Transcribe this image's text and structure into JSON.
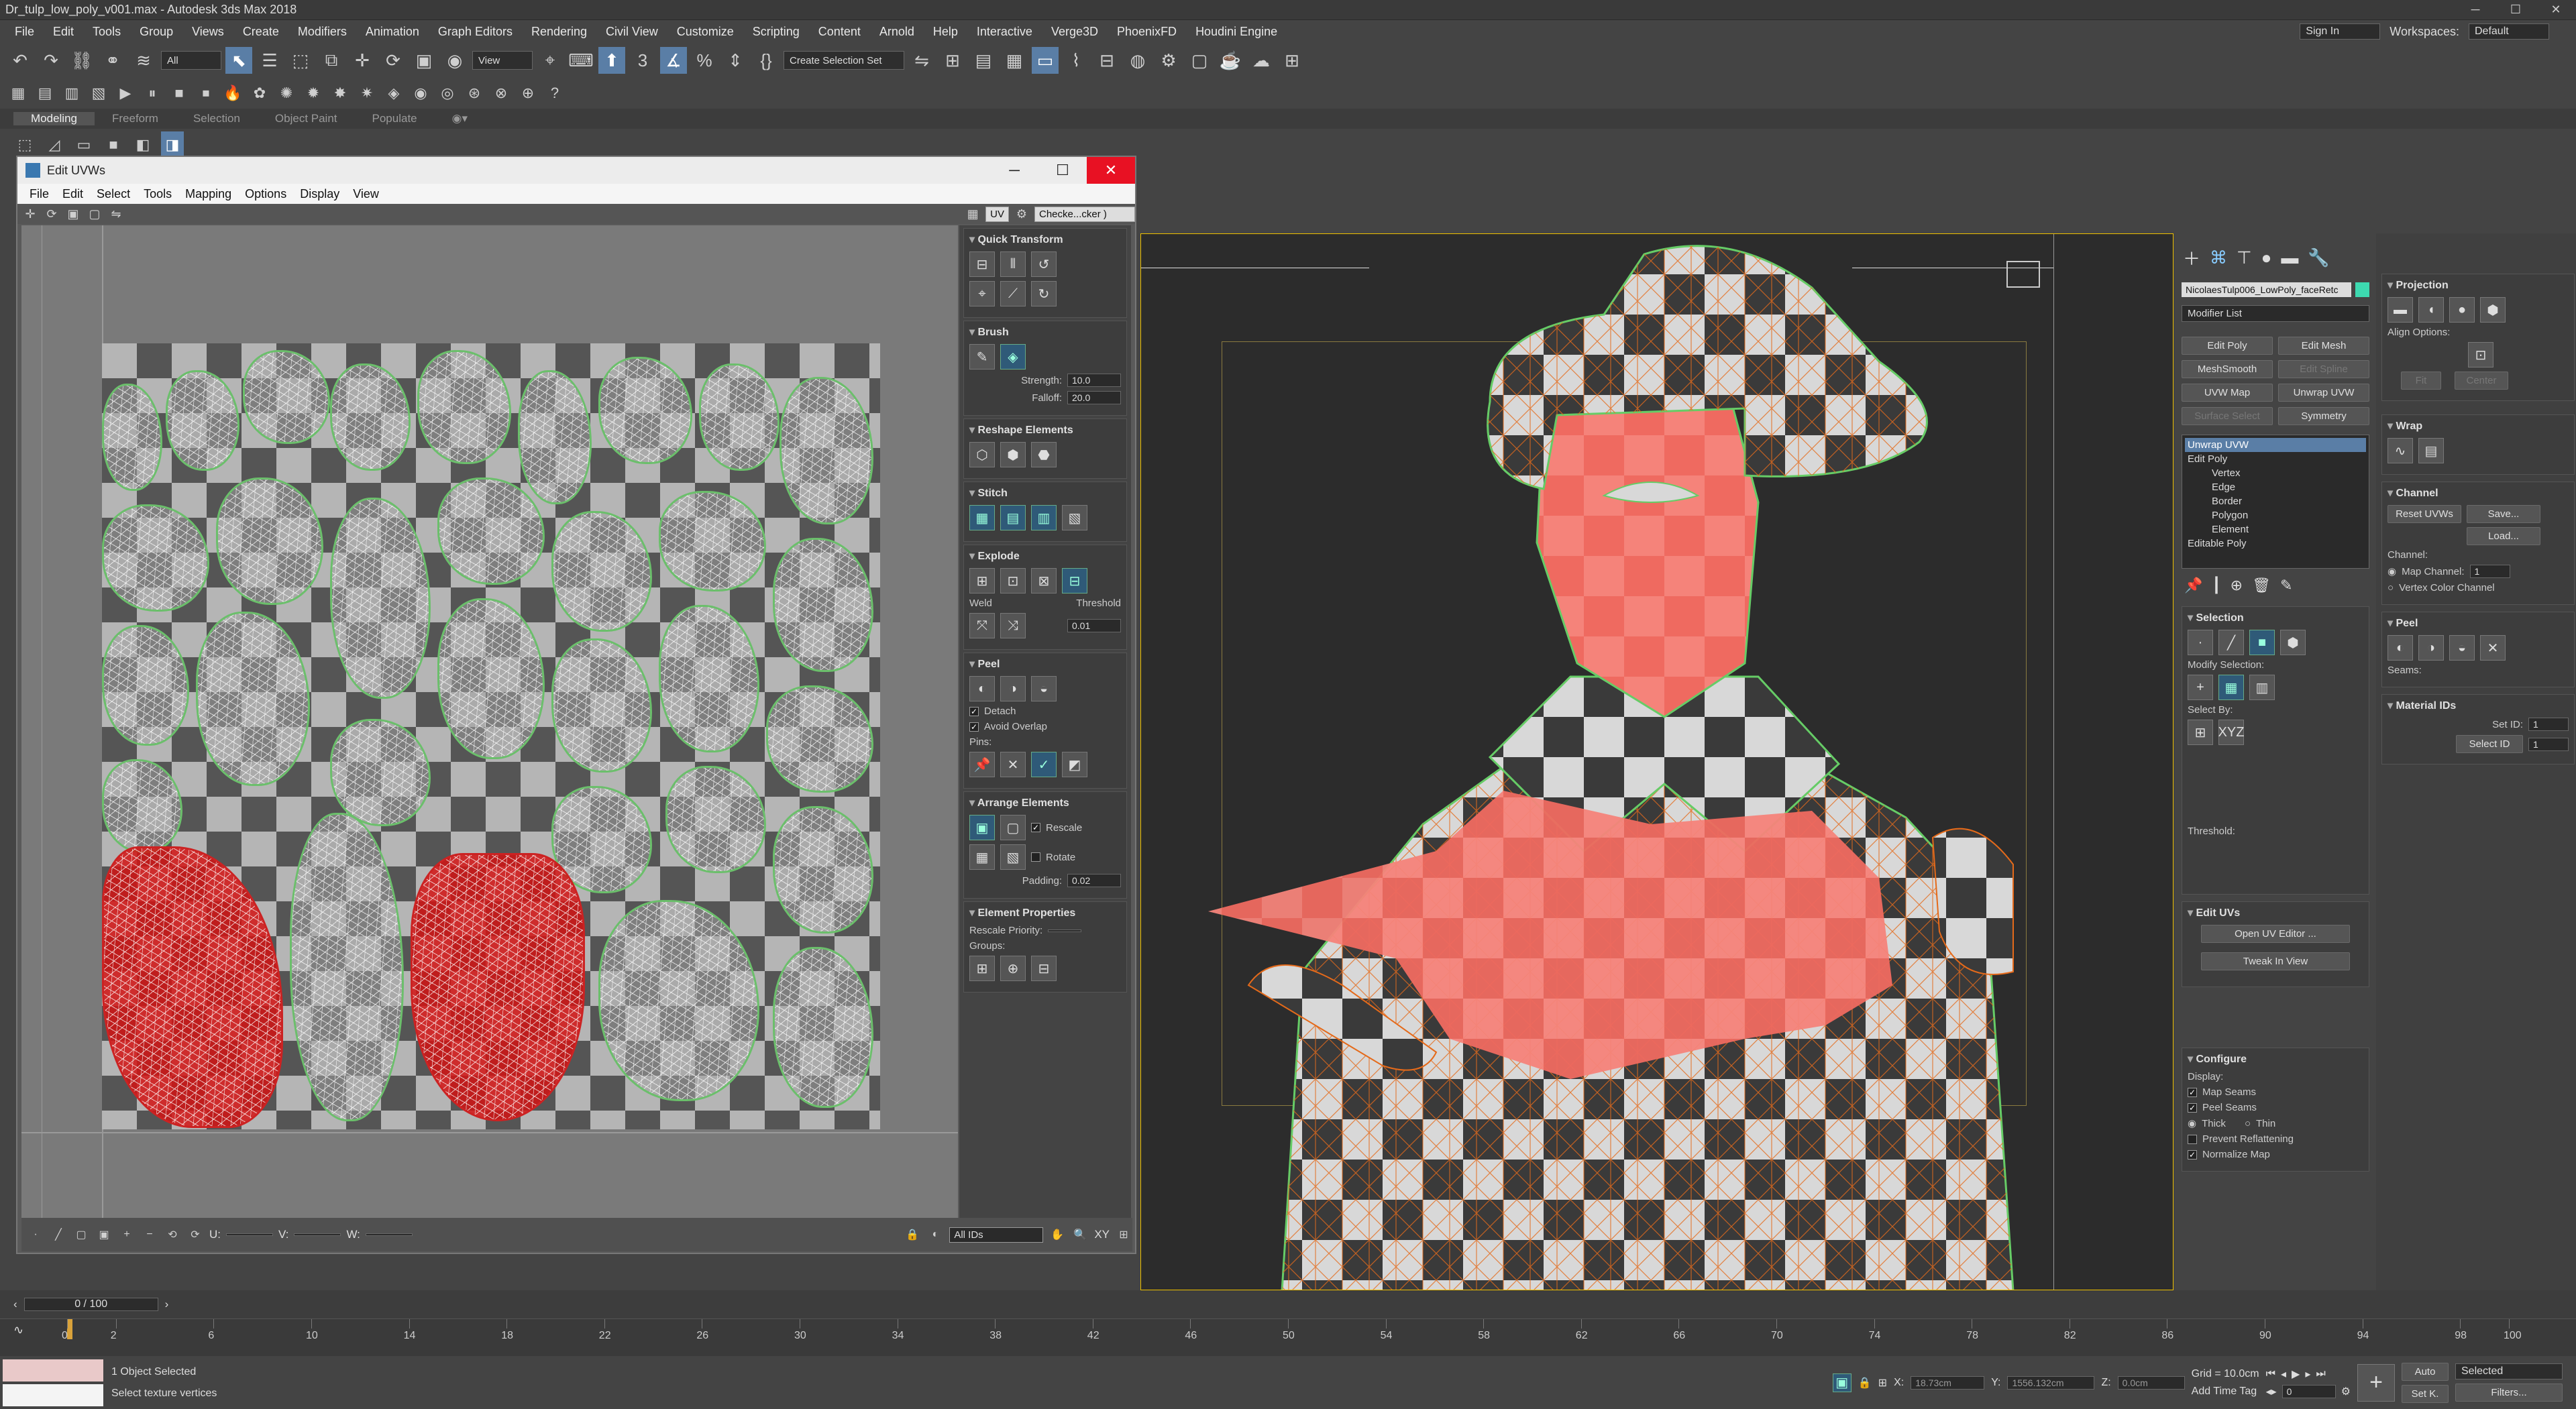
{
  "window": {
    "title": "Dr_tulp_low_poly_v001.max - Autodesk 3ds Max 2018"
  },
  "menu": [
    "File",
    "Edit",
    "Tools",
    "Group",
    "Views",
    "Create",
    "Modifiers",
    "Animation",
    "Graph Editors",
    "Rendering",
    "Civil View",
    "Customize",
    "Scripting",
    "Content",
    "Arnold",
    "Help",
    "Interactive",
    "Verge3D",
    "PhoenixFD",
    "Houdini Engine"
  ],
  "account": {
    "sign_in": "Sign In",
    "workspaces_label": "Workspaces:",
    "workspace": "Default"
  },
  "toolbar": {
    "selection_filter": "All",
    "ref_coord": "View",
    "named_selection": "Create Selection Set"
  },
  "ribbon": {
    "tabs": [
      "Modeling",
      "Freeform",
      "Selection",
      "Object Paint",
      "Populate"
    ]
  },
  "uvw_editor": {
    "title": "Edit UVWs",
    "menu": [
      "File",
      "Edit",
      "Select",
      "Tools",
      "Mapping",
      "Options",
      "Display",
      "View"
    ],
    "uv_label": "UV",
    "map_dropdown": "Checke...cker )",
    "rollouts": {
      "quick_transform": "Quick Transform",
      "brush": "Brush",
      "strength_label": "Strength:",
      "strength": "10.0",
      "falloff_label": "Falloff:",
      "falloff": "20.0",
      "reshape": "Reshape Elements",
      "stitch": "Stitch",
      "explode": "Explode",
      "weld": "Weld",
      "threshold_label": "Threshold",
      "threshold": "0.01",
      "peel": "Peel",
      "detach": "Detach",
      "avoid_overlap": "Avoid Overlap",
      "pins": "Pins:",
      "arrange": "Arrange Elements",
      "rescale": "Rescale",
      "rotate": "Rotate",
      "padding_label": "Padding:",
      "padding": "0.02",
      "element_props": "Element Properties",
      "rescale_priority": "Rescale Priority:",
      "groups": "Groups:"
    },
    "bottom": {
      "xy": "XY",
      "u_label": "U:",
      "v_label": "V:",
      "w_label": "W:",
      "ids": "All IDs"
    }
  },
  "command_panel": {
    "object_name": "NicolaesTulp006_LowPoly_faceRetc",
    "modifier_list": "Modifier List",
    "buttons": [
      "Edit Poly",
      "Edit Mesh",
      "MeshSmooth",
      "Edit Spline",
      "UVW Map",
      "Unwrap UVW",
      "Surface Select",
      "Symmetry"
    ],
    "stack": [
      "Unwrap UVW",
      "Edit Poly",
      "Vertex",
      "Edge",
      "Border",
      "Polygon",
      "Element",
      "Editable Poly"
    ],
    "selection": "Selection",
    "modify_selection": "Modify Selection:",
    "select_by": "Select By:",
    "threshold": "Threshold:",
    "edit_uvs": "Edit UVs",
    "open_uv_editor": "Open UV Editor ...",
    "tweak_in_view": "Tweak In View",
    "configure": "Configure",
    "display": "Display:",
    "map_seams": "Map Seams",
    "peel_seams": "Peel Seams",
    "thick": "Thick",
    "thin": "Thin",
    "prevent_reflattening": "Prevent Reflattening",
    "normalize_map": "Normalize Map",
    "projection": "Projection",
    "align_options": "Align Options:",
    "fit": "Fit",
    "center": "Center",
    "wrap": "Wrap",
    "channel": "Channel",
    "reset_uvws": "Reset UVWs",
    "save": "Save...",
    "load": "Load...",
    "channel_label": "Channel:",
    "map_channel": "Map Channel:",
    "map_channel_val": "1",
    "vertex_color": "Vertex Color Channel",
    "peel": "Peel",
    "seams": "Seams:",
    "material_ids": "Material IDs",
    "set_id": "Set ID:",
    "set_id_val": "1",
    "select_id": "Select ID",
    "select_id_val": "1"
  },
  "timeline": {
    "frame": "0 / 100",
    "ticks": [
      "0",
      "2",
      "6",
      "10",
      "14",
      "18",
      "22",
      "26",
      "30",
      "34",
      "38",
      "42",
      "46",
      "50",
      "54",
      "58",
      "62",
      "66",
      "70",
      "74",
      "78",
      "82",
      "86",
      "90",
      "94",
      "98",
      "100"
    ]
  },
  "status": {
    "objects": "1 Object Selected",
    "prompt": "Select texture vertices",
    "x_label": "X:",
    "x": "18.73cm",
    "y_label": "Y:",
    "y": "1556.132cm",
    "z_label": "Z:",
    "z": "0.0cm",
    "grid": "Grid = 10.0cm",
    "add_time_tag": "Add Time Tag",
    "auto": "Auto",
    "set_key": "Set K.",
    "selected": "Selected",
    "filters": "Filters...",
    "frame_field": "0"
  }
}
